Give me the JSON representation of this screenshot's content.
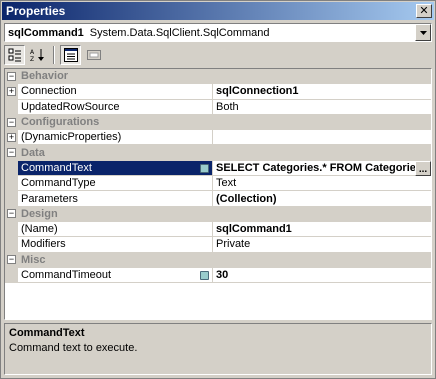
{
  "window": {
    "title": "Properties",
    "close_glyph": "✕"
  },
  "object_selector": {
    "name": "sqlCommand1",
    "type": "System.Data.SqlClient.SqlCommand"
  },
  "toolbar": {
    "icons": [
      "categorized-icon",
      "alphabetical-icon",
      "properties-icon",
      "events-icon"
    ]
  },
  "grid": {
    "categories": [
      {
        "label": "Behavior",
        "expanded": true
      },
      {
        "label": "Configurations",
        "expanded": true
      },
      {
        "label": "Data",
        "expanded": true
      },
      {
        "label": "Design",
        "expanded": true
      },
      {
        "label": "Misc",
        "expanded": true
      }
    ],
    "rows": [
      {
        "name": "Connection",
        "value": "sqlConnection1"
      },
      {
        "name": "UpdatedRowSource",
        "value": "Both"
      },
      {
        "name": "(DynamicProperties)",
        "value": ""
      },
      {
        "name": "CommandText",
        "value": "SELECT Categories.* FROM Categories"
      },
      {
        "name": "CommandType",
        "value": "Text"
      },
      {
        "name": "Parameters",
        "value": "(Collection)"
      },
      {
        "name": "(Name)",
        "value": "sqlCommand1"
      },
      {
        "name": "Modifiers",
        "value": "Private"
      },
      {
        "name": "CommandTimeout",
        "value": "30"
      }
    ],
    "ellipsis": "..."
  },
  "description": {
    "title": "CommandText",
    "text": "Command text to execute."
  },
  "colors": {
    "selection": "#0a246a",
    "face": "#d4d0c8",
    "category_text": "#808080"
  }
}
